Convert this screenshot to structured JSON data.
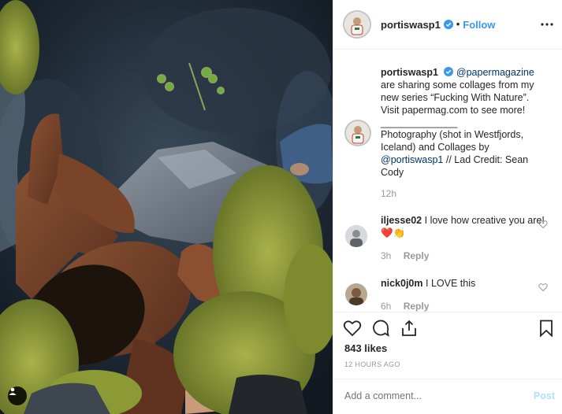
{
  "post": {
    "username": "portiswasp1",
    "follow_label": "Follow",
    "dot": "•"
  },
  "caption": {
    "username": "portiswasp1",
    "mention": "@papermagazine",
    "text": "are sharing some collages from my new series “Fucking With Nature”. Visit papermag.com to see more!",
    "divider": "______________",
    "text2": "Photography (shot in Westfjords, Iceland) and Collages by",
    "mention2": "@portiswasp1",
    "text3": "// Lad Credit: Sean Cody",
    "age": "12h"
  },
  "comments": [
    {
      "username": "iljesse02",
      "text": "I love how creative you are! ❤️👏",
      "age": "3h",
      "reply_label": "Reply"
    },
    {
      "username": "nick0j0m",
      "text": "I LOVE this",
      "age": "6h",
      "reply_label": "Reply"
    }
  ],
  "stats": {
    "likes": "843 likes",
    "timestamp": "12 HOURS AGO"
  },
  "composer": {
    "placeholder": "Add a comment...",
    "post_label": "Post"
  },
  "colors": {
    "link": "#3897f0",
    "text": "#262626",
    "muted": "#999999",
    "post_disabled": "#b2dffc"
  },
  "icons": [
    "verified-badge-icon",
    "more-options-icon",
    "heart-icon",
    "comment-icon",
    "share-icon",
    "bookmark-icon",
    "user-tag-icon"
  ]
}
